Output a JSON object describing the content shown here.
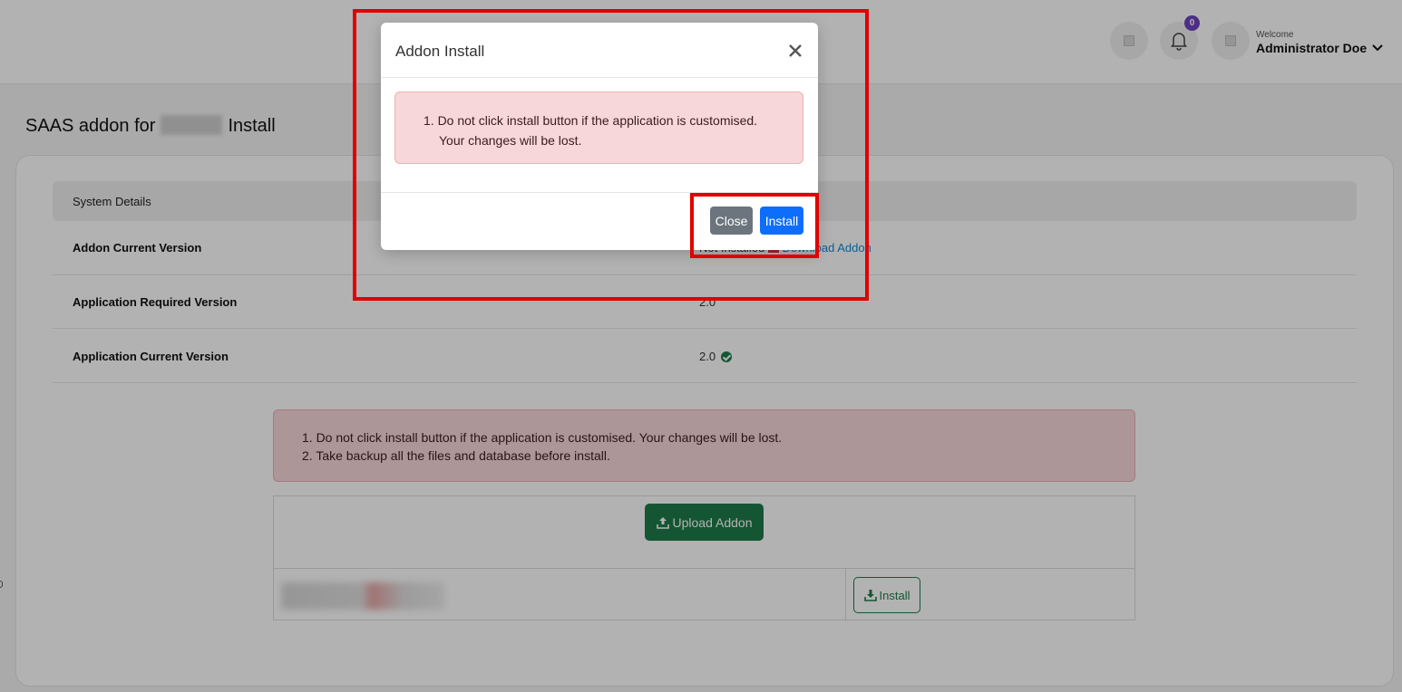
{
  "topbar": {
    "notification_count": "0",
    "welcome_label": "Welcome",
    "user_name": "Administrator Doe"
  },
  "page": {
    "title_prefix": "SAAS addon for",
    "title_suffix": "Install"
  },
  "system_details": {
    "header": "System Details",
    "rows": [
      {
        "label": "Addon Current Version",
        "value": "Not Installed",
        "link": "Download Addon"
      },
      {
        "label": "Application Required Version",
        "value": "2.0"
      },
      {
        "label": "Application Current Version",
        "value": "2.0"
      }
    ]
  },
  "warning": {
    "line1": "1. Do not click install button if the application is customised. Your changes will be lost.",
    "line2": "2. Take backup all the files and database before install."
  },
  "upload": {
    "upload_label": "Upload Addon",
    "install_label": "Install"
  },
  "modal": {
    "title": "Addon Install",
    "alert_line1": "1. Do not click install button if the application is customised.",
    "alert_line2": "Your changes will be lost.",
    "close_label": "Close",
    "install_label": "Install"
  },
  "colors": {
    "accent_green": "#1e7c4a",
    "primary_blue": "#0d6efd",
    "highlight_red": "#e10000",
    "badge_purple": "#6f42c1"
  }
}
